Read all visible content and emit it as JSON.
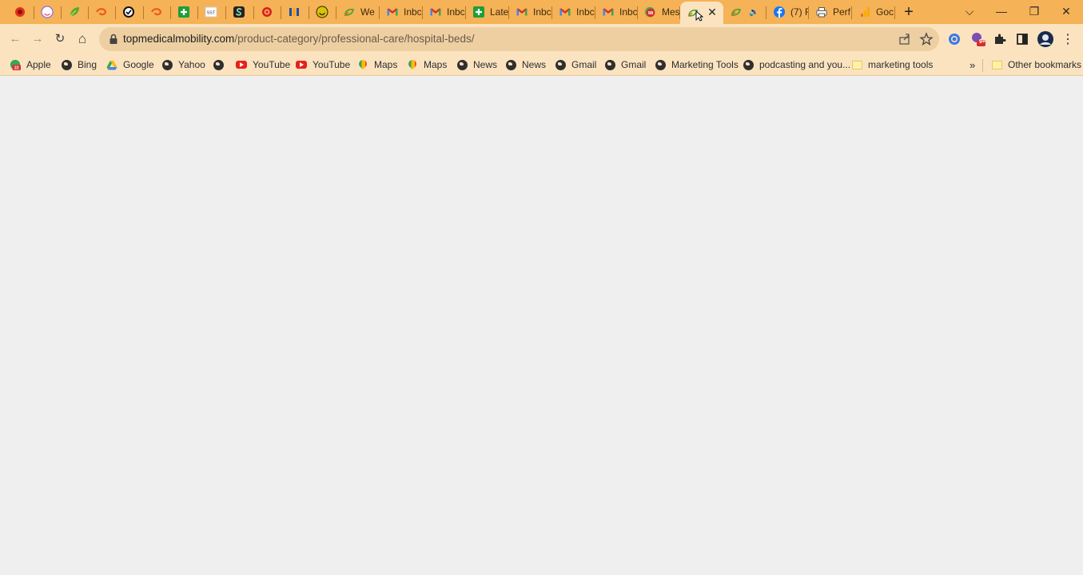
{
  "tabs": [
    {
      "title": "",
      "icon": "red-circle-icon",
      "color": "#e0301e"
    },
    {
      "title": "",
      "icon": "white-face-icon",
      "color": "#ffffff"
    },
    {
      "title": "",
      "icon": "leaf-icon",
      "color": "#5aa832"
    },
    {
      "title": "",
      "icon": "orange-swirl-icon",
      "color": "#e85d1c"
    },
    {
      "title": "",
      "icon": "check-circle-icon",
      "color": "#111111"
    },
    {
      "title": "",
      "icon": "orange-swirl-icon",
      "color": "#e85d1c"
    },
    {
      "title": "",
      "icon": "green-plus-icon",
      "color": "#1e9e3a"
    },
    {
      "title": "",
      "icon": "sst-icon",
      "color": "#ffffff"
    },
    {
      "title": "",
      "icon": "green-s-icon",
      "color": "#1e7f4a"
    },
    {
      "title": "",
      "icon": "red-target-icon",
      "color": "#d62020"
    },
    {
      "title": "",
      "icon": "blue-m-icon",
      "color": "#1f4fa8"
    },
    {
      "title": "",
      "icon": "yellow-smile-icon",
      "color": "#d9c400"
    },
    {
      "title": "We",
      "icon": "green-sprout-icon",
      "color": "#4aa52e"
    },
    {
      "title": "Inbc",
      "icon": "gmail-icon",
      "color": "#d93025"
    },
    {
      "title": "Inbc",
      "icon": "gmail-icon",
      "color": "#d93025"
    },
    {
      "title": "Late",
      "icon": "green-plus-icon",
      "color": "#1e9e3a"
    },
    {
      "title": "Inbc",
      "icon": "gmail-icon",
      "color": "#d93025"
    },
    {
      "title": "Inbc",
      "icon": "gmail-icon",
      "color": "#d93025"
    },
    {
      "title": "Inbc",
      "icon": "gmail-icon",
      "color": "#d93025"
    },
    {
      "title": "Mes",
      "icon": "chat-badge-icon",
      "badge": "98",
      "color": "#2e7d32"
    },
    {
      "title": "",
      "icon": "loading-spinner-icon",
      "color": "#4aa52e",
      "active": true
    },
    {
      "title": "",
      "icon": "green-sprout-icon",
      "color": "#4aa52e",
      "audio": true
    },
    {
      "title": "(7) F",
      "icon": "facebook-icon",
      "color": "#1877f2"
    },
    {
      "title": "Perf",
      "icon": "printer-icon",
      "color": "#5a5a5a"
    },
    {
      "title": "Goc",
      "icon": "analytics-icon",
      "color": "#f9ab00"
    }
  ],
  "window_controls": {
    "tab_search": "⌵",
    "minimize": "—",
    "maximize": "❐",
    "close": "✕"
  },
  "toolbar": {
    "back": "←",
    "forward": "→",
    "reload": "↻",
    "home": "⌂",
    "url_host": "topmedicalmobility.com",
    "url_path": "/product-category/professional-care/hospital-beds/",
    "extension_badge": "9+"
  },
  "bookmarks": [
    {
      "label": "Apple",
      "icon": "apple-badge-icon",
      "badge": "22"
    },
    {
      "label": "Bing",
      "icon": "globe-icon"
    },
    {
      "label": "Google",
      "icon": "google-drive-icon"
    },
    {
      "label": "Yahoo",
      "icon": "globe-icon"
    },
    {
      "label": "",
      "icon": "globe-icon"
    },
    {
      "label": "YouTube",
      "icon": "youtube-icon"
    },
    {
      "label": "YouTube",
      "icon": "youtube-icon"
    },
    {
      "label": "Maps",
      "icon": "maps-pin-icon"
    },
    {
      "label": "Maps",
      "icon": "maps-pin-icon"
    },
    {
      "label": "News",
      "icon": "globe-icon"
    },
    {
      "label": "News",
      "icon": "globe-icon"
    },
    {
      "label": "Gmail",
      "icon": "globe-icon"
    },
    {
      "label": "Gmail",
      "icon": "globe-icon"
    },
    {
      "label": "Marketing Tools",
      "icon": "globe-icon"
    },
    {
      "label": "podcasting and you...",
      "icon": "globe-icon"
    },
    {
      "label": "marketing tools",
      "icon": "folder-icon"
    }
  ],
  "bookmarks_overflow": "»",
  "other_bookmarks": "Other bookmarks"
}
